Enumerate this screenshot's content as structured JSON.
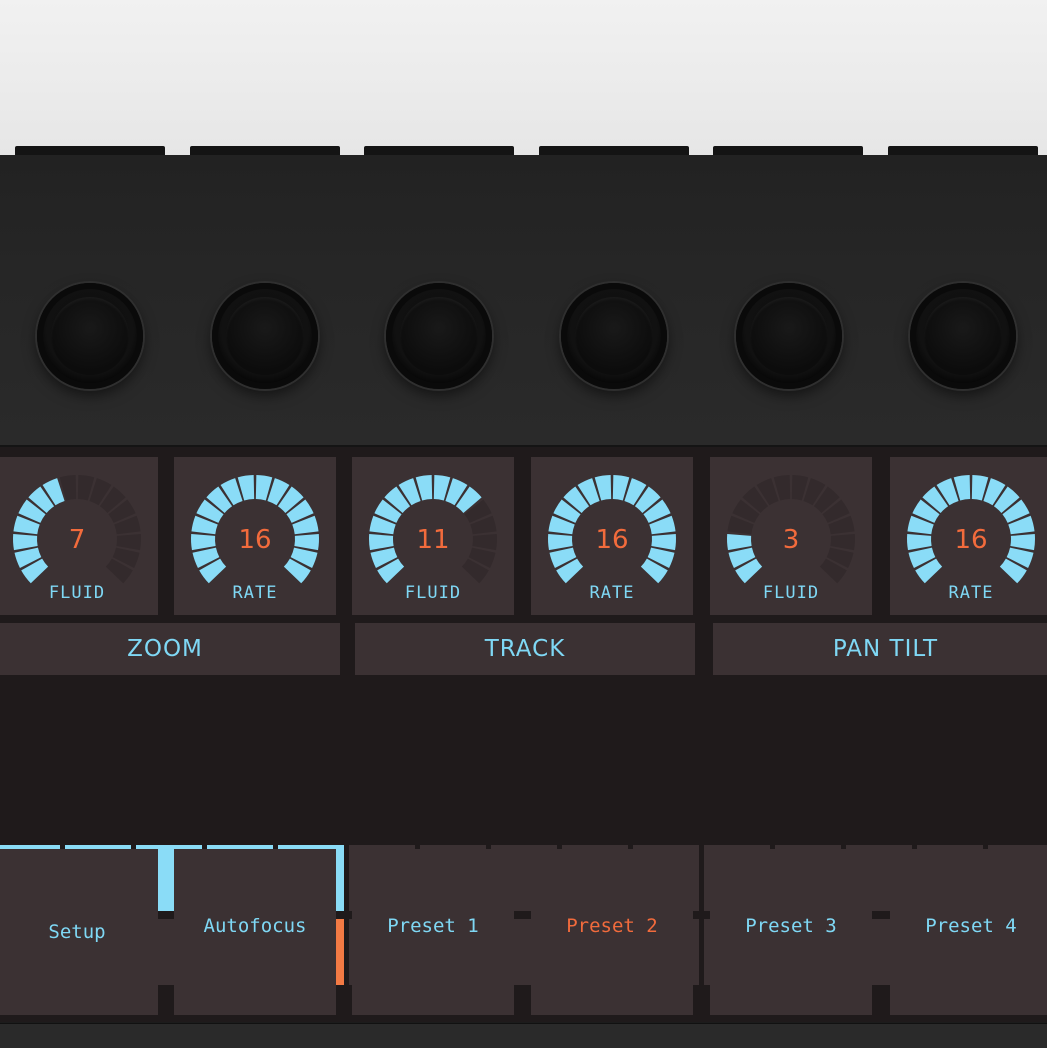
{
  "colors": {
    "accent_blue": "#8adcf7",
    "label_blue": "#7fd8f5",
    "accent_orange": "#f26b3c",
    "cell_bg": "#3b3133",
    "device_body": "#262626"
  },
  "dials": [
    {
      "value": "7",
      "label": "FLUID",
      "level": 0.44
    },
    {
      "value": "16",
      "label": "RATE",
      "level": 1.0
    },
    {
      "value": "11",
      "label": "FLUID",
      "level": 0.69
    },
    {
      "value": "16",
      "label": "RATE",
      "level": 1.0
    },
    {
      "value": "3",
      "label": "FLUID",
      "level": 0.19
    },
    {
      "value": "16",
      "label": "RATE",
      "level": 1.0
    }
  ],
  "groups": [
    "ZOOM",
    "TRACK",
    "PAN TILT"
  ],
  "pad_grid": {
    "columns": 15,
    "lit_top_row": [
      0,
      1,
      2,
      3,
      4
    ],
    "bottom_row_numbers": {
      "4": "2",
      "8": "1",
      "11": "4"
    },
    "selected_bottom": 4
  },
  "buttons": [
    {
      "label": "Setup",
      "active": false
    },
    {
      "label": "Autofocus",
      "active": false
    },
    {
      "label": "Preset 1",
      "active": false
    },
    {
      "label": "Preset 2",
      "active": true
    },
    {
      "label": "Preset 3",
      "active": false
    },
    {
      "label": "Preset 4",
      "active": false
    }
  ],
  "knob_count": 6
}
